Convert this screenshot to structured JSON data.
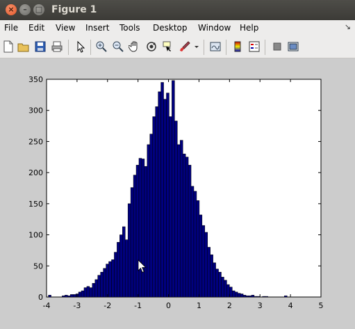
{
  "window": {
    "title": "Figure 1",
    "close_glyph": "×",
    "min_glyph": "–",
    "max_glyph": "□"
  },
  "menu": [
    {
      "label": "File"
    },
    {
      "label": "Edit"
    },
    {
      "label": "View"
    },
    {
      "label": "Insert"
    },
    {
      "label": "Tools"
    },
    {
      "label": "Desktop"
    },
    {
      "label": "Window"
    },
    {
      "label": "Help"
    }
  ],
  "menu_dock_glyph": "↘",
  "toolbar_icons": [
    "new-figure-icon",
    "open-file-icon",
    "save-icon",
    "print-icon",
    "edit-plot-arrow-icon",
    "zoom-in-icon",
    "zoom-out-icon",
    "pan-hand-icon",
    "rotate-3d-icon",
    "data-cursor-icon",
    "brush-icon",
    "brush-dropdown-icon",
    "link-plot-icon",
    "colorbar-icon",
    "legend-icon",
    "hide-plot-tools-icon",
    "show-plot-tools-icon"
  ],
  "chart_data": {
    "type": "bar",
    "title": "",
    "xlabel": "",
    "ylabel": "",
    "xlim": [
      -4,
      5
    ],
    "ylim": [
      0,
      350
    ],
    "xticks": [
      -4,
      -3,
      -2,
      -1,
      0,
      1,
      2,
      3,
      4,
      5
    ],
    "yticks": [
      0,
      50,
      100,
      150,
      200,
      250,
      300,
      350
    ],
    "bar_color": "#00007f",
    "edge_color": "#000000",
    "bin_width": 0.09,
    "bin_centers": [
      -3.895,
      -3.805,
      -3.715,
      -3.625,
      -3.535,
      -3.445,
      -3.355,
      -3.265,
      -3.175,
      -3.085,
      -2.995,
      -2.905,
      -2.815,
      -2.725,
      -2.635,
      -2.545,
      -2.455,
      -2.365,
      -2.275,
      -2.185,
      -2.095,
      -2.005,
      -1.915,
      -1.825,
      -1.735,
      -1.645,
      -1.555,
      -1.465,
      -1.375,
      -1.285,
      -1.195,
      -1.105,
      -1.015,
      -0.925,
      -0.835,
      -0.745,
      -0.655,
      -0.565,
      -0.475,
      -0.385,
      -0.295,
      -0.205,
      -0.115,
      -0.025,
      0.065,
      0.155,
      0.245,
      0.335,
      0.425,
      0.515,
      0.605,
      0.695,
      0.785,
      0.875,
      0.965,
      1.055,
      1.145,
      1.235,
      1.325,
      1.415,
      1.505,
      1.595,
      1.685,
      1.775,
      1.865,
      1.955,
      2.045,
      2.135,
      2.225,
      2.315,
      2.405,
      2.495,
      2.585,
      2.675,
      2.765,
      2.855,
      2.945,
      3.035,
      3.125,
      3.215,
      3.305,
      3.395,
      3.485,
      3.575,
      3.665,
      3.755,
      3.845,
      3.935,
      4.025,
      4.115,
      4.205
    ],
    "values": [
      3,
      0,
      0,
      0,
      0,
      2,
      3,
      2,
      4,
      4,
      5,
      8,
      10,
      15,
      17,
      15,
      22,
      28,
      35,
      40,
      46,
      53,
      57,
      60,
      72,
      88,
      100,
      113,
      92,
      150,
      176,
      196,
      212,
      223,
      222,
      210,
      245,
      262,
      290,
      306,
      330,
      345,
      318,
      328,
      290,
      348,
      283,
      245,
      252,
      230,
      225,
      212,
      178,
      170,
      155,
      132,
      115,
      104,
      80,
      68,
      55,
      45,
      40,
      32,
      27,
      20,
      16,
      10,
      8,
      6,
      5,
      3,
      2,
      2,
      3,
      1,
      1,
      0,
      1,
      1,
      0,
      0,
      0,
      0,
      0,
      0,
      2,
      0,
      0,
      0,
      0
    ]
  }
}
